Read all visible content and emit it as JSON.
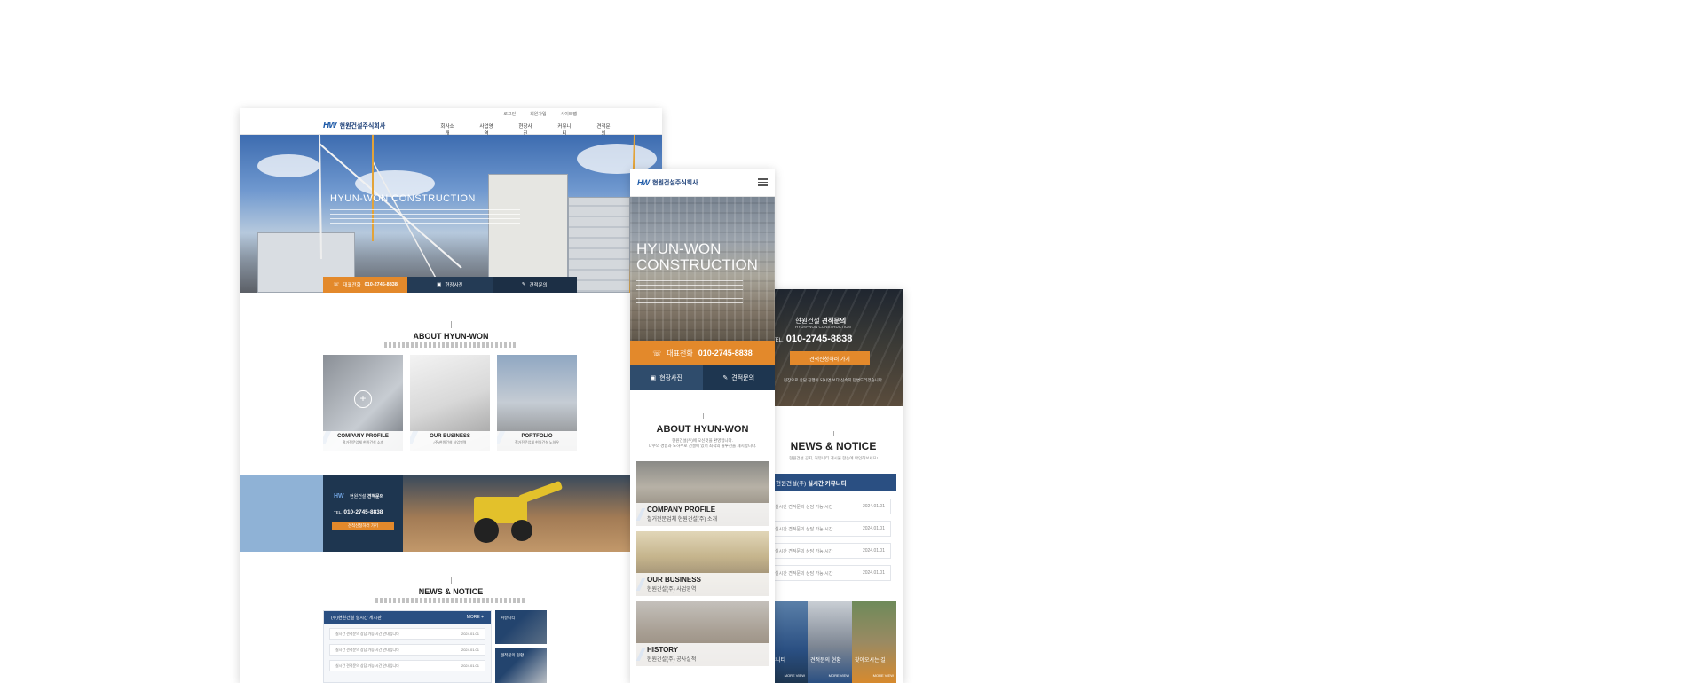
{
  "desktop": {
    "util_links": [
      "로그인",
      "회원가입",
      "사이트맵"
    ],
    "logo_mark": "HW",
    "logo_text": "현원건설주식회사",
    "menu": [
      "회사소개",
      "사업영역",
      "현장사진",
      "커뮤니티",
      "견적문의"
    ],
    "hero_title": "HYUN-WON CONSTRUCTION",
    "hero_bar": {
      "call_label": "대표전화",
      "call_number": "010-2745-8838",
      "photos": "현장사진",
      "quote": "견적문의"
    },
    "about_title": "ABOUT HYUN-WON",
    "cards": [
      {
        "title": "COMPANY PROFILE",
        "sub": "철거전문업체 현원건설 소개"
      },
      {
        "title": "OUR BUSINESS",
        "sub": "(주)현원건설 사업영역"
      },
      {
        "title": "PORTFOLIO",
        "sub": "철거전문업체 현원건설 노하우"
      }
    ],
    "banner": {
      "brand": "현원건설",
      "title": "견적문의",
      "tel_label": "TEL.",
      "tel": "010-2745-8838",
      "button": "견적신청하러 가기"
    },
    "news_title": "NEWS & NOTICE",
    "news_head": "(주)현원건설 실시간 게시판",
    "news_more": "MORE +",
    "news_rows": [
      "실시간 견적문의 상담 가능 시간 안내입니다",
      "실시간 견적문의 상담 가능 시간 안내입니다",
      "실시간 견적문의 상담 가능 시간 안내입니다"
    ],
    "news_date": "2024.01.01",
    "tiles": [
      "커뮤니티",
      "견적문의 현황"
    ]
  },
  "mobile1": {
    "logo_text": "현원건설주식회사",
    "hero_title": "HYUN-WON CONSTRUCTION",
    "call_label": "대표전화",
    "call_number": "010-2745-8838",
    "btn_photos": "현장사진",
    "btn_quote": "견적문의",
    "about_title": "ABOUT HYUN-WON",
    "about_lines": [
      "현원건설(주)에 오신것을 환영합니다.",
      "다수의 경험과 노하우로 건설에 있어 최적의 솔루션을 제시합니다."
    ],
    "cards": [
      {
        "title": "COMPANY PROFILE",
        "sub": "철거전문업체 현원건설(주) 소개"
      },
      {
        "title": "OUR BUSINESS",
        "sub": "현원건설(주) 사업영역"
      },
      {
        "title": "HISTORY",
        "sub": "현원건설(주) 공사실적"
      }
    ]
  },
  "mobile2": {
    "brand": "현원건설",
    "title": "견적문의",
    "brand_en": "HYUN-WON CONSTRUCTION",
    "tel_label": "TEL.",
    "tel": "010-2745-8838",
    "button": "견적신청하러 가기",
    "desc": "현장으로 상담 진행이 되시면 보다 신속히 답변드리겠습니다.",
    "news_title": "NEWS & NOTICE",
    "news_sub": "현원건설 공지, 커뮤니티 게시물 한눈에 확인해보세요!",
    "news_head_pre": "현원건설(주)",
    "news_head": "실시간 커뮤니티",
    "news_rows": [
      "실시간 견적문의 상담 가능 시간",
      "실시간 견적문의 상담 가능 시간",
      "실시간 견적문의 상담 가능 시간",
      "실시간 견적문의 상담 가능 시간"
    ],
    "news_date": "2024.01.01",
    "tiles": [
      {
        "label": "커뮤니티",
        "more": "MORE VIEW"
      },
      {
        "label": "견적문의 현황",
        "more": "MORE VIEW"
      },
      {
        "label": "찾아오시는 길",
        "more": "MORE VIEW"
      }
    ]
  },
  "colors": {
    "navy": "#1e3650",
    "orange": "#e3892b",
    "blue": "#2a4f82",
    "sky": "#8fb2d6"
  }
}
